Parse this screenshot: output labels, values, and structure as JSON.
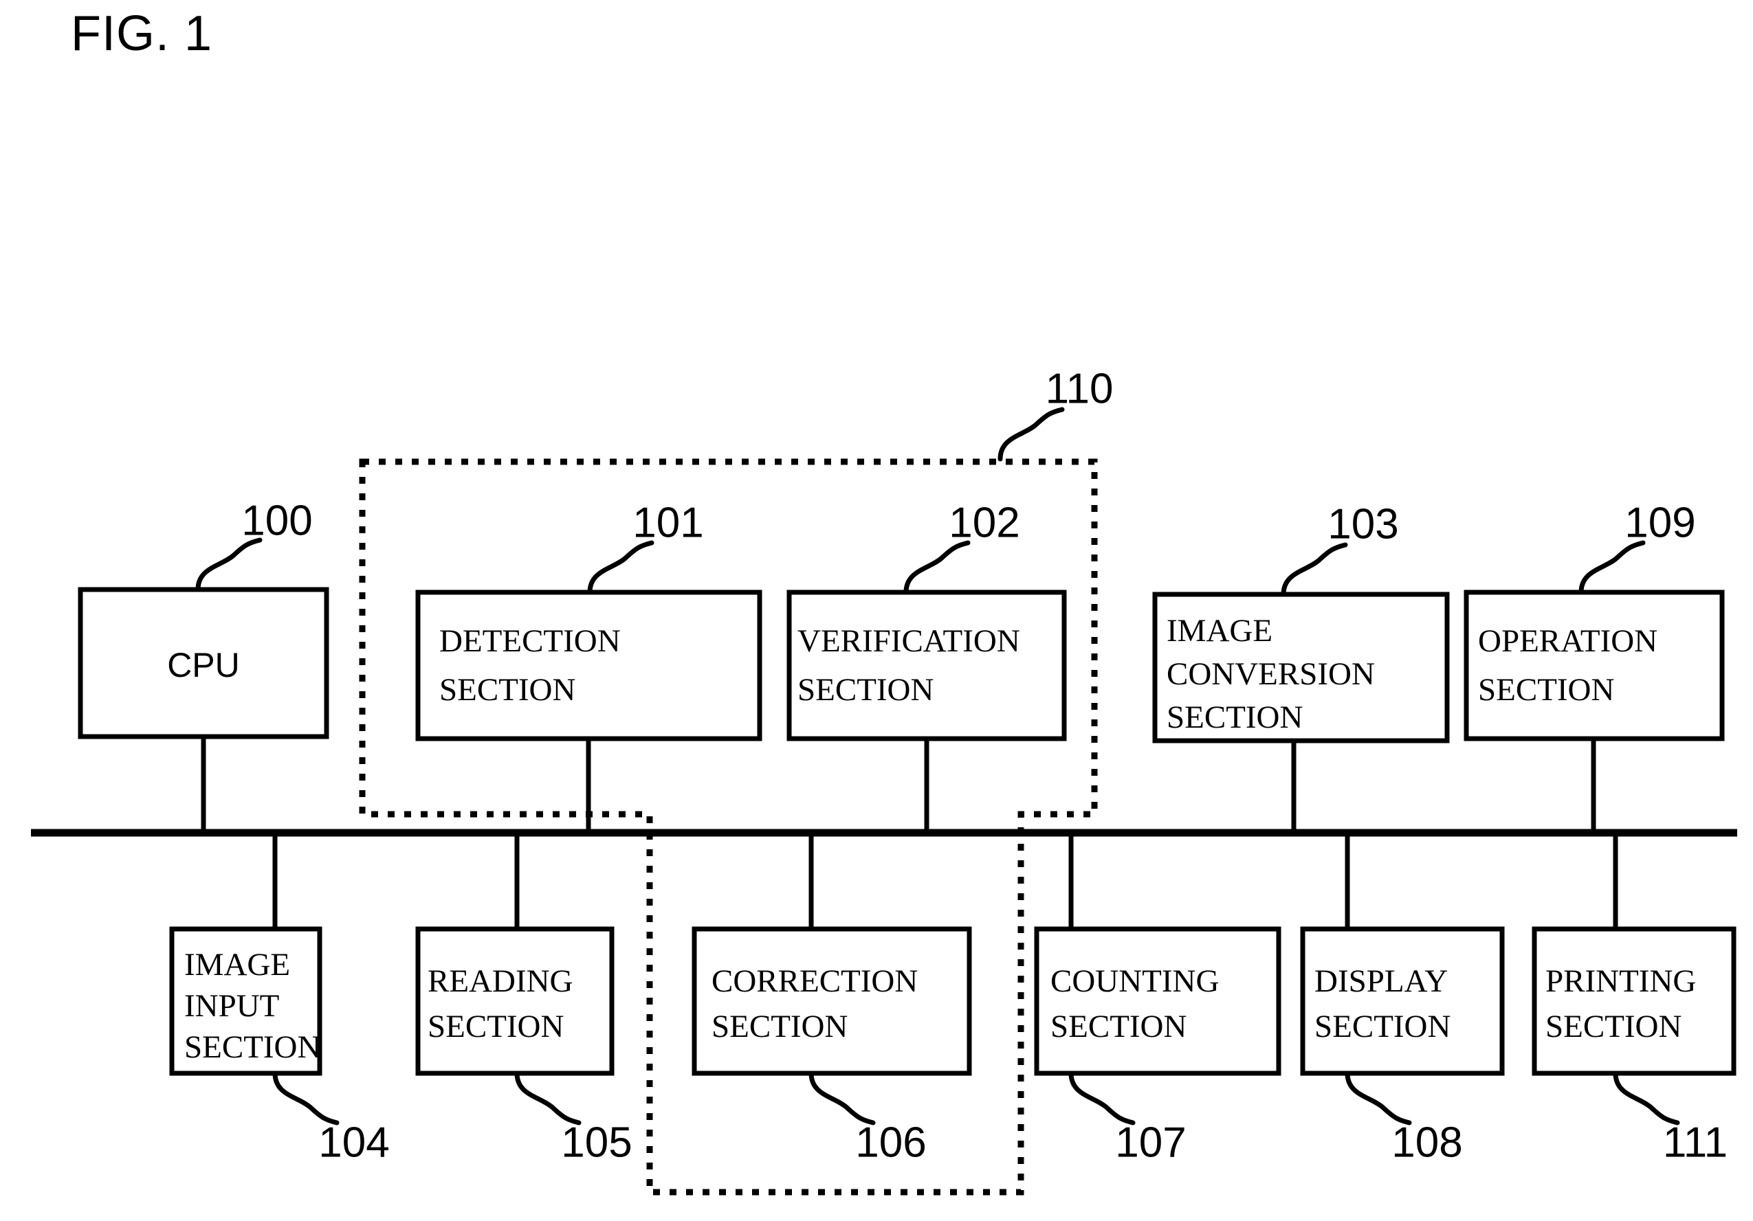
{
  "figure": {
    "title": "FIG. 1",
    "type": "patent-block-diagram"
  },
  "bus": {
    "label": "system-bus"
  },
  "boxes": {
    "cpu": {
      "ref": "100",
      "lines": [
        "CPU"
      ]
    },
    "detection": {
      "ref": "101",
      "lines": [
        "DETECTION",
        "SECTION"
      ]
    },
    "verification": {
      "ref": "102",
      "lines": [
        "VERIFICATION",
        "SECTION"
      ]
    },
    "image_conversion": {
      "ref": "103",
      "lines": [
        "IMAGE",
        "CONVERSION",
        "SECTION"
      ]
    },
    "operation": {
      "ref": "109",
      "lines": [
        "OPERATION",
        "SECTION"
      ]
    },
    "image_input": {
      "ref": "104",
      "lines": [
        "IMAGE",
        "INPUT",
        "SECTION"
      ]
    },
    "reading": {
      "ref": "105",
      "lines": [
        "READING",
        "SECTION"
      ]
    },
    "correction": {
      "ref": "106",
      "lines": [
        "CORRECTION",
        "SECTION"
      ]
    },
    "counting": {
      "ref": "107",
      "lines": [
        "COUNTING",
        "SECTION"
      ]
    },
    "display": {
      "ref": "108",
      "lines": [
        "DISPLAY",
        "SECTION"
      ]
    },
    "printing": {
      "ref": "111",
      "lines": [
        "PRINTING",
        "SECTION"
      ]
    }
  },
  "group": {
    "ref": "110",
    "label": "dotted-enclosure"
  },
  "colors": {
    "ink": "#000000",
    "paper": "#ffffff"
  }
}
